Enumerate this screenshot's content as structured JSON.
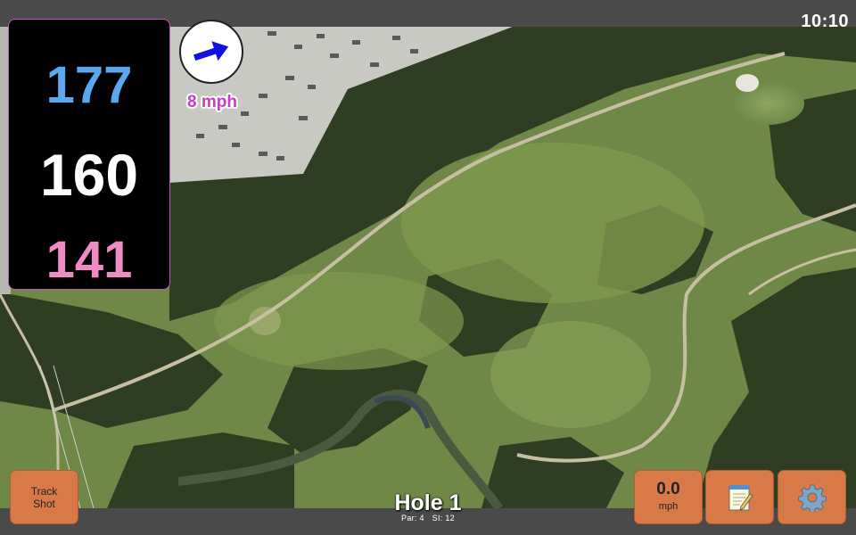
{
  "status_bar": {
    "time": "10:10"
  },
  "distances": {
    "back": "177",
    "middle": "160",
    "front": "141"
  },
  "wind": {
    "speed": "8 mph",
    "direction_icon": "arrow-right-icon",
    "arrow_color": "#1010e0"
  },
  "hole": {
    "title": "Hole 1",
    "par": "Par: 4",
    "stroke_index": "SI: 12"
  },
  "buttons": {
    "track_shot_line1": "Track",
    "track_shot_line2": "Shot",
    "speed_value": "0.0",
    "speed_unit": "mph",
    "notes_icon": "notepad-icon",
    "settings_icon": "gear-icon"
  },
  "colors": {
    "back_distance": "#5aa8f0",
    "middle_distance": "#ffffff",
    "front_distance": "#f08ac4",
    "button": "#d77a48",
    "wind_text": "#c83ec8",
    "bar": "#4a4a4a"
  }
}
